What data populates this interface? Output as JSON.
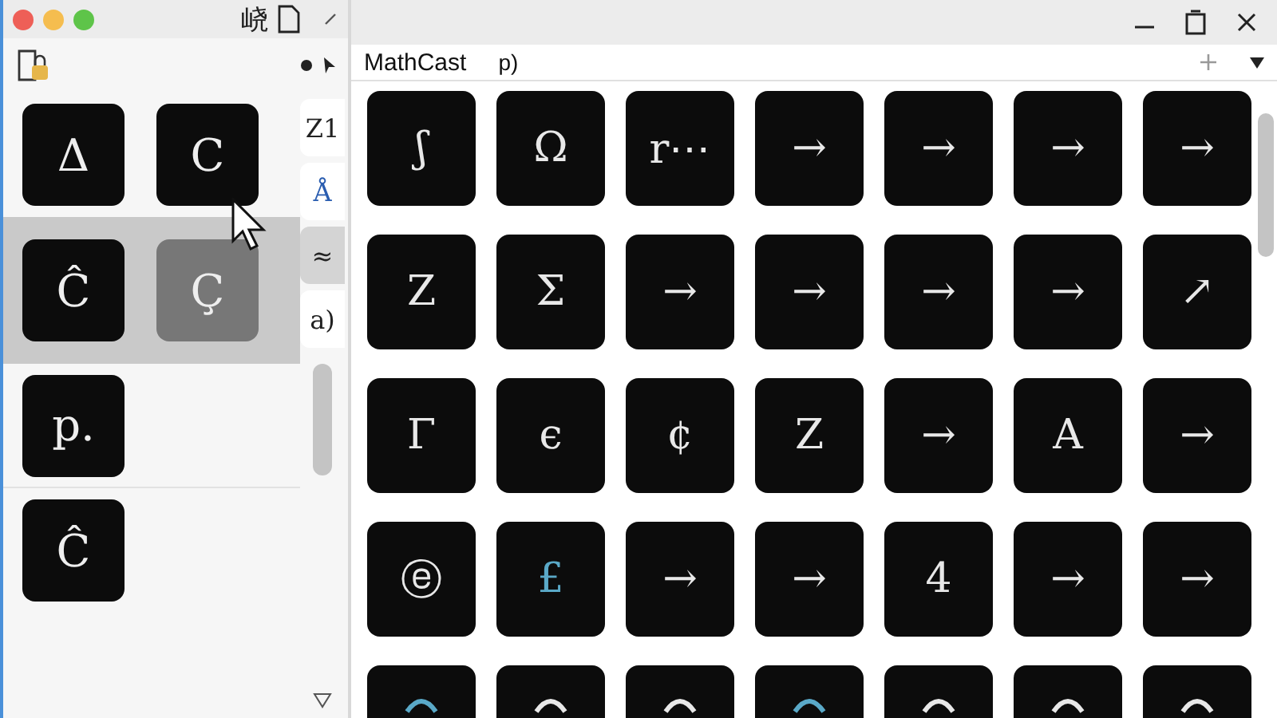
{
  "left_window": {
    "title_glyph": "峣",
    "rows": [
      {
        "selected": false,
        "tiles": [
          {
            "glyph": "Δ",
            "selected": false
          },
          {
            "glyph": "C",
            "selected": false
          }
        ]
      },
      {
        "selected": true,
        "tiles": [
          {
            "glyph": "Ĉ",
            "selected": false
          },
          {
            "glyph": "Ç",
            "selected": true
          }
        ]
      },
      {
        "selected": false,
        "tiles": [
          {
            "glyph": "p.",
            "selected": false
          }
        ]
      },
      {
        "selected": false,
        "tiles": [
          {
            "glyph": "Ĉ",
            "selected": false
          }
        ]
      }
    ],
    "side_tabs": [
      {
        "label": "Z1",
        "selected": false,
        "color": "#222222"
      },
      {
        "label": "Å",
        "selected": false,
        "color": "#2a5db0"
      },
      {
        "label": "≈",
        "selected": true,
        "color": "#222222"
      },
      {
        "label": "a)",
        "selected": false,
        "color": "#222222"
      }
    ]
  },
  "right_window": {
    "tabs": [
      {
        "label": "MathCast",
        "selected": true
      },
      {
        "label": "p)",
        "selected": false
      }
    ],
    "tiles": [
      {
        "glyph": "ʃ"
      },
      {
        "glyph": "Ω"
      },
      {
        "glyph": "r⋯"
      },
      {
        "glyph": "→"
      },
      {
        "glyph": "→"
      },
      {
        "glyph": "→"
      },
      {
        "glyph": "→"
      },
      {
        "glyph": "Z"
      },
      {
        "glyph": "Σ"
      },
      {
        "glyph": "→"
      },
      {
        "glyph": "→"
      },
      {
        "glyph": "→"
      },
      {
        "glyph": "→"
      },
      {
        "glyph": "↗"
      },
      {
        "glyph": "Γ"
      },
      {
        "glyph": "є"
      },
      {
        "glyph": "¢"
      },
      {
        "glyph": "Z"
      },
      {
        "glyph": "→"
      },
      {
        "glyph": "A"
      },
      {
        "glyph": "→"
      },
      {
        "glyph": "ⓔ"
      },
      {
        "glyph": "£",
        "color": "#5aa9c8"
      },
      {
        "glyph": "→"
      },
      {
        "glyph": "→"
      },
      {
        "glyph": "4"
      },
      {
        "glyph": "→"
      },
      {
        "glyph": "→"
      },
      {
        "color": "#5aa9c8"
      },
      {
        "color": "#e8e8e8"
      },
      {
        "color": "#e8e8e8"
      },
      {
        "color": "#5aa9c8"
      },
      {
        "color": "#e8e8e8"
      },
      {
        "color": "#e8e8e8"
      },
      {
        "color": "#e8e8e8"
      }
    ]
  }
}
